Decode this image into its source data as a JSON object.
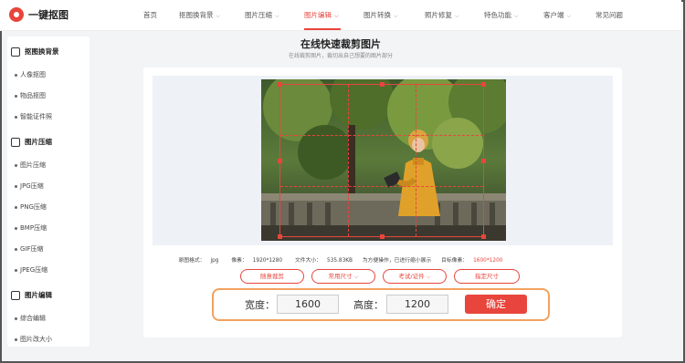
{
  "logo": {
    "text": "一键抠图"
  },
  "nav": {
    "items": [
      {
        "label": "首页",
        "dropdown": false
      },
      {
        "label": "抠图换背景",
        "dropdown": true
      },
      {
        "label": "图片压缩",
        "dropdown": true
      },
      {
        "label": "图片编辑",
        "dropdown": true,
        "active": true
      },
      {
        "label": "图片转换",
        "dropdown": true
      },
      {
        "label": "照片修复",
        "dropdown": true
      },
      {
        "label": "特色功能",
        "dropdown": true
      },
      {
        "label": "客户端",
        "dropdown": true
      },
      {
        "label": "常见问题",
        "dropdown": false
      }
    ]
  },
  "sidebar": {
    "groups": [
      {
        "title": "抠图换背景",
        "items": [
          "人像抠图",
          "物品抠图",
          "智能证件照"
        ]
      },
      {
        "title": "图片压缩",
        "items": [
          "图片压缩",
          "JPG压缩",
          "PNG压缩",
          "BMP压缩",
          "GIF压缩",
          "JPEG压缩"
        ]
      },
      {
        "title": "图片编辑",
        "items": [
          "综合编辑",
          "图片改大小"
        ]
      }
    ]
  },
  "page": {
    "title": "在线快速裁剪图片",
    "subtitle": "在线裁剪图片，裁切出自己想要的图片部分"
  },
  "info": {
    "format_label": "原图格式：",
    "format_value": "jpg",
    "pixels_label": "像素：",
    "pixels_value": "1920*1280",
    "size_label": "文件大小：",
    "size_value": "535.83KB",
    "note": "为方便操作，已进行缩小展示",
    "target_label": "目标像素：",
    "target_value": "1600*1200"
  },
  "pills": {
    "free": "随意裁剪",
    "common": "常用尺寸",
    "exam": "考试/证件",
    "custom": "指定尺寸"
  },
  "form": {
    "width_label": "宽度：",
    "width_value": "1600",
    "height_label": "高度：",
    "height_value": "1200",
    "confirm": "确定"
  },
  "colors": {
    "accent": "#e8453c",
    "highlight_border": "#f2a25e"
  }
}
